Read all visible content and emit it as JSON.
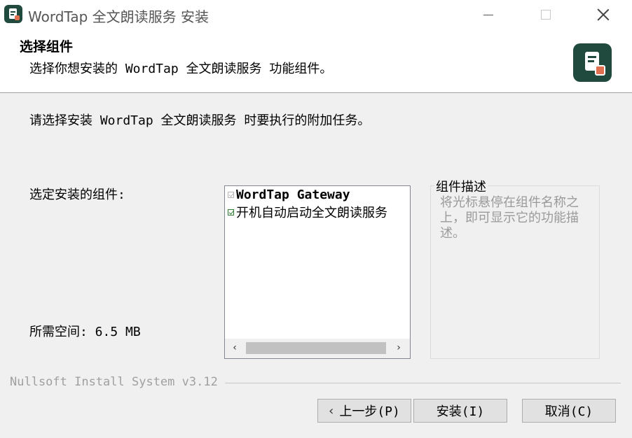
{
  "window": {
    "title": "WordTap 全文朗读服务 安装"
  },
  "header": {
    "title": "选择组件",
    "subtitle": "选择你想安装的 WordTap 全文朗读服务 功能组件。"
  },
  "main": {
    "intro": "请选择安装 WordTap 全文朗读服务 时要执行的附加任务。",
    "select_label": "选定安装的组件:",
    "space_required": "所需空间: 6.5 MB",
    "components": [
      {
        "label": "WordTap Gateway",
        "checked": true,
        "disabled": true
      },
      {
        "label": "开机自动启动全文朗读服务",
        "checked": true,
        "disabled": false
      }
    ],
    "description": {
      "legend": "组件描述",
      "text": "将光标悬停在组件名称之上，即可显示它的功能描述。"
    }
  },
  "footer": {
    "branding": "Nullsoft Install System v3.12",
    "back_label": "上一步(P)",
    "install_label": "安装(I)",
    "cancel_label": "取消(C)"
  },
  "colors": {
    "accent": "#1f4a3d",
    "logo_dot": "#e0704f",
    "check": "#2e7d32"
  }
}
